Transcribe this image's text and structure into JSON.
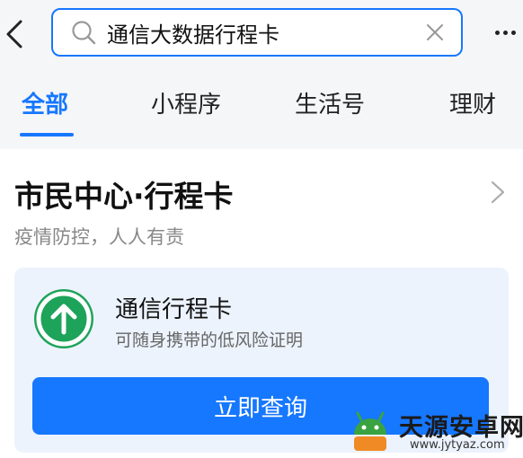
{
  "search": {
    "value": "通信大数据行程卡",
    "icons": {
      "back": "chevron-left-icon",
      "search": "search-icon",
      "clear": "close-icon",
      "more": "more-dots-icon"
    }
  },
  "tabs": [
    {
      "label": "全部",
      "active": true
    },
    {
      "label": "小程序",
      "active": false
    },
    {
      "label": "生活号",
      "active": false
    },
    {
      "label": "理财",
      "active": false
    }
  ],
  "result": {
    "title": "市民中心·行程卡",
    "subtitle": "疫情防控，人人有责",
    "service": {
      "name": "通信行程卡",
      "description": "可随身携带的低风险证明",
      "icon": "green-up-arrow-icon",
      "button_label": "立即查询"
    }
  },
  "watermark": {
    "name": "天源安卓网",
    "url": "www.jytyaz.com"
  },
  "colors": {
    "accent": "#1677ff",
    "icon_green": "#1ea35a",
    "service_bg": "#ecf3fd",
    "page_bg": "#f5f6f8"
  }
}
